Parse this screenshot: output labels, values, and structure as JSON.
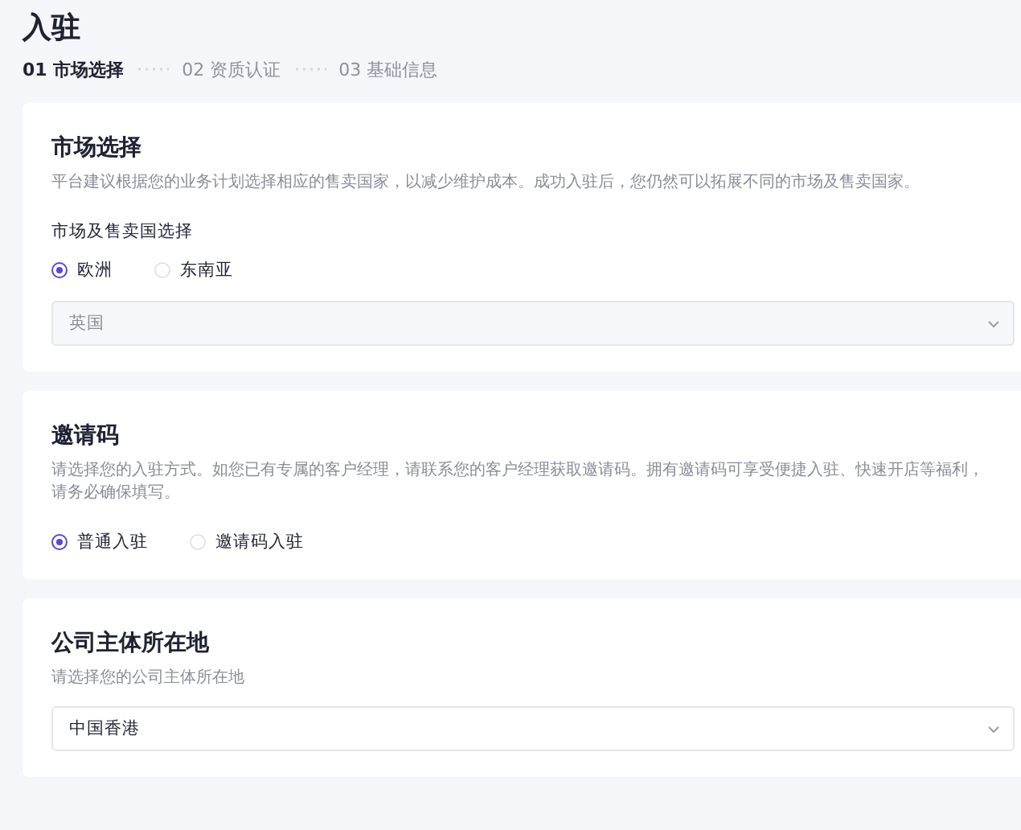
{
  "page": {
    "title": "入驻"
  },
  "steps": [
    {
      "label": "01 市场选择",
      "selected": true
    },
    {
      "label": "02 资质认证",
      "selected": false
    },
    {
      "label": "03 基础信息",
      "selected": false
    }
  ],
  "sections": [
    {
      "title": "市场选择",
      "description": "平台建议根据您的业务计划选择相应的售卖国家，以减少维护成本。成功入驻后，您仍然可以拓展不同的市场及售卖国家。",
      "fields": [
        {
          "kind": "label",
          "text": "市场及售卖国选择"
        },
        {
          "kind": "radio",
          "options": [
            {
              "label": "欧洲",
              "selected": true
            },
            {
              "label": "东南亚",
              "selected": false
            }
          ]
        },
        {
          "kind": "select",
          "value": "英国",
          "filled": false
        }
      ]
    },
    {
      "title": "邀请码",
      "description": "请选择您的入驻方式。如您已有专属的客户经理，请联系您的客户经理获取邀请码。拥有邀请码可享受便捷入驻、快速开店等福利，请务必确保填写。",
      "fields": [
        {
          "kind": "radio",
          "options": [
            {
              "label": "普通入驻",
              "selected": true
            },
            {
              "label": "邀请码入驻",
              "selected": false
            }
          ]
        }
      ]
    },
    {
      "title": "公司主体所在地",
      "description": "请选择您的公司主体所在地",
      "fields": [
        {
          "kind": "select",
          "value": "中国香港",
          "filled": true
        }
      ]
    }
  ]
}
